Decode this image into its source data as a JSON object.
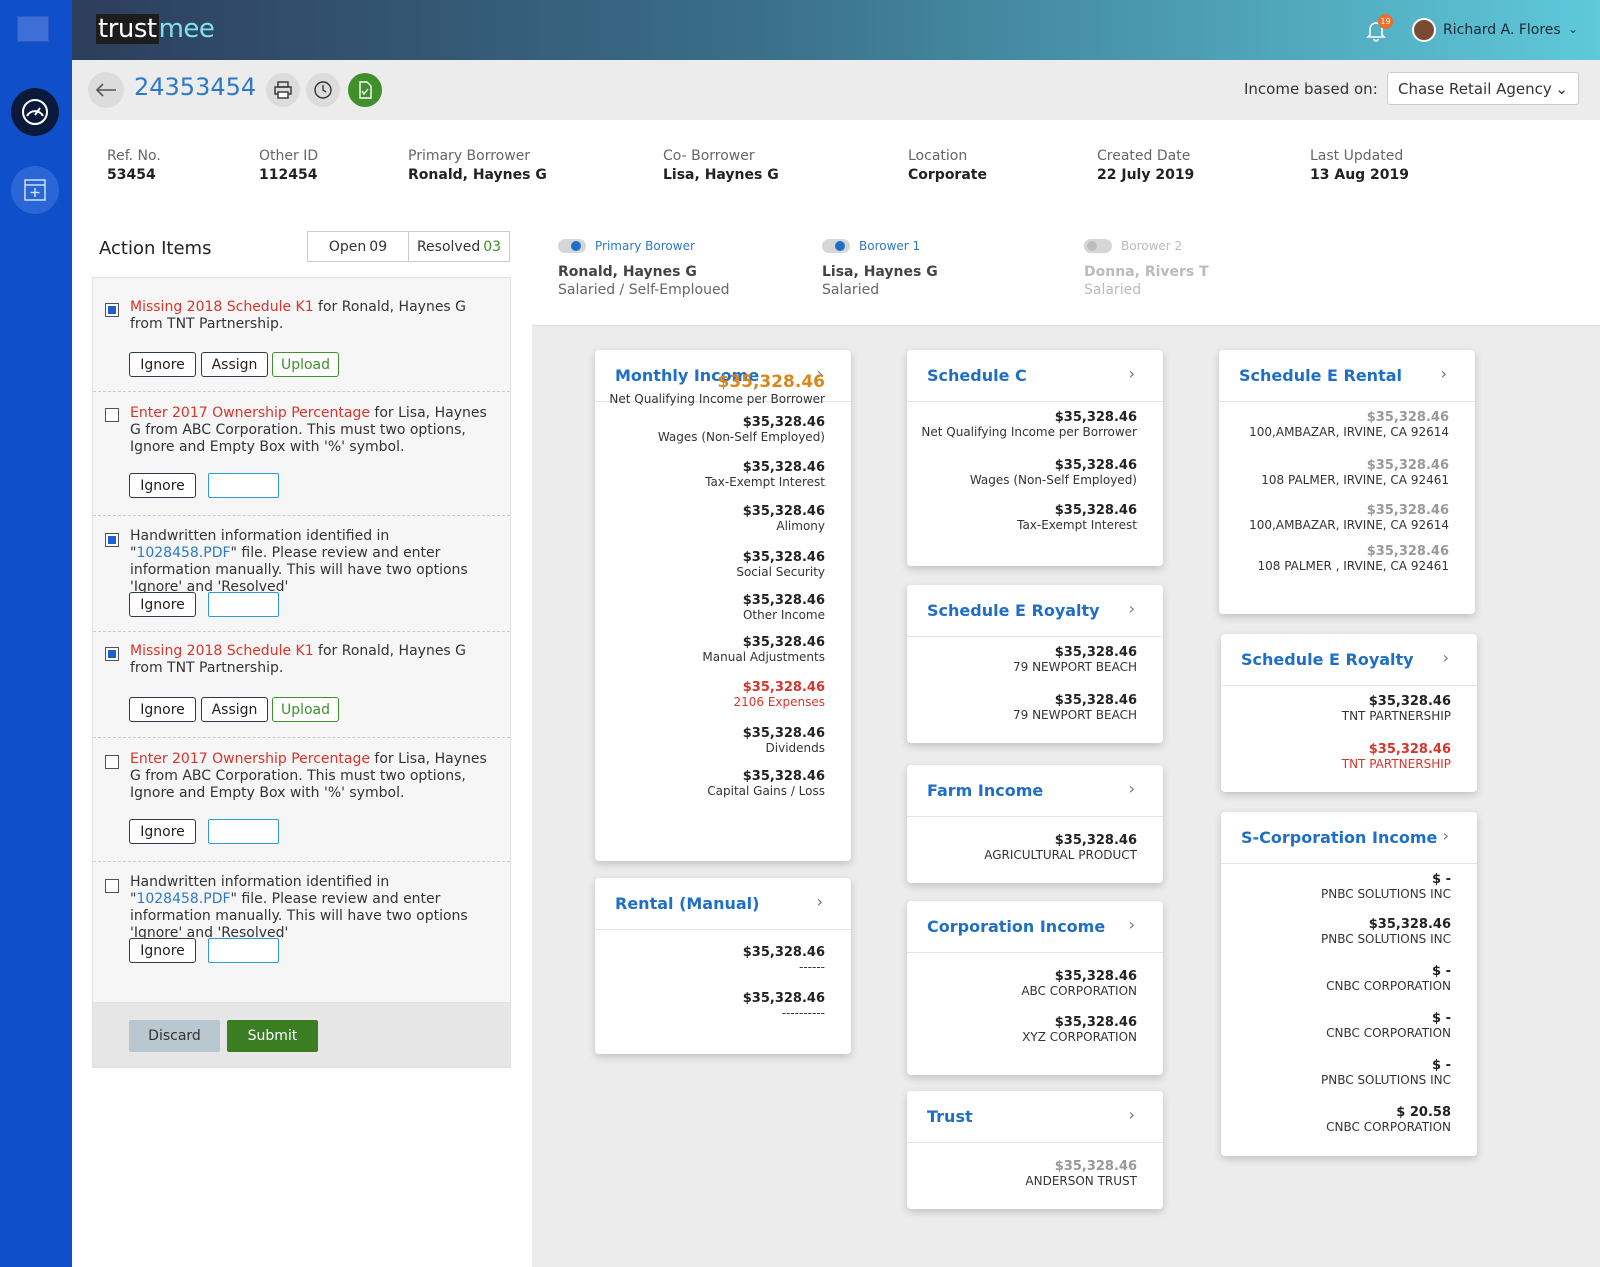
{
  "brand": {
    "part1": "trust",
    "part2": "mee"
  },
  "user": {
    "name": "Richard A. Flores",
    "notifications": "19"
  },
  "loan": {
    "id": "24353454"
  },
  "income_based": {
    "label": "Income based on:",
    "selected": "Chase Retail Agency"
  },
  "info": [
    {
      "label": "Ref. No.",
      "value": "53454"
    },
    {
      "label": "Other ID",
      "value": "112454"
    },
    {
      "label": "Primary Borrower",
      "value": "Ronald, Haynes G"
    },
    {
      "label": "Co- Borrower",
      "value": "Lisa, Haynes G"
    },
    {
      "label": "Location",
      "value": "Corporate"
    },
    {
      "label": "Created Date",
      "value": "22 July 2019"
    },
    {
      "label": "Last Updated",
      "value": "13 Aug 2019"
    }
  ],
  "action_items": {
    "title": "Action Items",
    "open_label": "Open",
    "open_count": "09",
    "resolved_label": "Resolved",
    "resolved_count": "03",
    "items": [
      {
        "checked": true,
        "highlight": "Missing 2018 Schedule K1",
        "text": " for Ronald, Haynes G from TNT Partnership.",
        "buttons": [
          "Ignore",
          "Assign",
          "Upload"
        ]
      },
      {
        "checked": false,
        "highlight": "Enter 2017 Ownership Percentage",
        "text": " for Lisa, Haynes G from ABC Corporation. This must two options, Ignore and Empty Box with '%' symbol.",
        "buttons": [
          "Ignore"
        ]
      },
      {
        "checked": true,
        "pre": "Handwritten information identified in \"",
        "link": "1028458.PDF",
        "post": "\" file. Please review and enter information manually. This will have two options 'Ignore' and 'Resolved'",
        "buttons": [
          "Ignore"
        ]
      },
      {
        "checked": true,
        "highlight": "Missing 2018 Schedule K1",
        "text": " for Ronald, Haynes G from TNT Partnership.",
        "buttons": [
          "Ignore",
          "Assign",
          "Upload"
        ]
      },
      {
        "checked": false,
        "highlight": "Enter 2017 Ownership Percentage",
        "text": " for Lisa, Haynes G from ABC Corporation. This must two options, Ignore and Empty Box with '%' symbol.",
        "buttons": [
          "Ignore"
        ]
      },
      {
        "checked": false,
        "pre": "Handwritten information identified in \"",
        "link": "1028458.PDF",
        "post": "\" file. Please review and enter information manually. This will have two options 'Ignore' and 'Resolved'",
        "buttons": [
          "Ignore"
        ]
      }
    ],
    "discard_label": "Discard",
    "submit_label": "Submit"
  },
  "borrowers": [
    {
      "toggle": "Primary Borower",
      "name": "Ronald, Haynes G",
      "type": "Salaried / Self-Emploued",
      "enabled": true
    },
    {
      "toggle": "Borower 1",
      "name": "Lisa, Haynes G",
      "type": "Salaried",
      "enabled": true
    },
    {
      "toggle": "Borower 2",
      "name": "Donna, Rivers T",
      "type": "Salaried",
      "enabled": false
    }
  ],
  "cards": {
    "monthly": {
      "title": "Monthly Income",
      "rows": [
        {
          "amount": "$35,328.46",
          "label": "Net Qualifying Income per Borrower",
          "style": "big"
        },
        {
          "amount": "$35,328.46",
          "label": "Wages (Non-Self Employed)"
        },
        {
          "amount": "$35,328.46",
          "label": "Tax-Exempt Interest"
        },
        {
          "amount": "$35,328.46",
          "label": "Alimony"
        },
        {
          "amount": "$35,328.46",
          "label": "Social Security"
        },
        {
          "amount": "$35,328.46",
          "label": "Other Income"
        },
        {
          "amount": "$35,328.46",
          "label": "Manual Adjustments"
        },
        {
          "amount": "$35,328.46",
          "label": "2106 Expenses",
          "style": "red"
        },
        {
          "amount": "$35,328.46",
          "label": "Dividends"
        },
        {
          "amount": "$35,328.46",
          "label": "Capital Gains / Loss"
        }
      ]
    },
    "rental_manual": {
      "title": "Rental (Manual)",
      "rows": [
        {
          "amount": "$35,328.46",
          "label": "------"
        },
        {
          "amount": "$35,328.46",
          "label": "----------"
        }
      ]
    },
    "schedule_c": {
      "title": "Schedule C",
      "rows": [
        {
          "amount": "$35,328.46",
          "label": "Net Qualifying Income per Borrower"
        },
        {
          "amount": "$35,328.46",
          "label": "Wages (Non-Self Employed)"
        },
        {
          "amount": "$35,328.46",
          "label": "Tax-Exempt Interest"
        }
      ]
    },
    "royalty_mid": {
      "title": "Schedule E Royalty",
      "rows": [
        {
          "amount": "$35,328.46",
          "label": "79 NEWPORT BEACH"
        },
        {
          "amount": "$35,328.46",
          "label": "79 NEWPORT BEACH"
        }
      ]
    },
    "farm": {
      "title": "Farm Income",
      "rows": [
        {
          "amount": "$35,328.46",
          "label": "AGRICULTURAL PRODUCT"
        }
      ]
    },
    "corporation": {
      "title": "Corporation Income",
      "rows": [
        {
          "amount": "$35,328.46",
          "label": "ABC CORPORATION"
        },
        {
          "amount": "$35,328.46",
          "label": "XYZ CORPORATION"
        }
      ]
    },
    "trust": {
      "title": "Trust",
      "rows": [
        {
          "amount": "$35,328.46",
          "label": "ANDERSON TRUST",
          "style": "grey"
        }
      ]
    },
    "rental_e": {
      "title": "Schedule E Rental",
      "rows": [
        {
          "amount": "$35,328.46",
          "label": "100,AMBAZAR, IRVINE, CA 92614",
          "style": "grey"
        },
        {
          "amount": "$35,328.46",
          "label": "108 PALMER, IRVINE, CA 92461",
          "style": "grey"
        },
        {
          "amount": "$35,328.46",
          "label": "100,AMBAZAR, IRVINE, CA 92614",
          "style": "grey"
        },
        {
          "amount": "$35,328.46",
          "label": "108 PALMER , IRVINE, CA 92461",
          "style": "grey"
        }
      ]
    },
    "royalty_right": {
      "title": "Schedule E Royalty",
      "rows": [
        {
          "amount": "$35,328.46",
          "label": "TNT PARTNERSHIP"
        },
        {
          "amount": "$35,328.46",
          "label": "TNT PARTNERSHIP",
          "style": "red"
        }
      ]
    },
    "scorp": {
      "title": "S-Corporation Income",
      "rows": [
        {
          "amount": "$ -",
          "label": "PNBC SOLUTIONS INC"
        },
        {
          "amount": "$35,328.46",
          "label": "PNBC SOLUTIONS INC"
        },
        {
          "amount": "$ -",
          "label": "CNBC CORPORATION"
        },
        {
          "amount": "$ -",
          "label": "CNBC CORPORATION"
        },
        {
          "amount": "$ -",
          "label": "PNBC SOLUTIONS INC"
        },
        {
          "amount": "$ 20.58",
          "label": "CNBC CORPORATION"
        }
      ]
    }
  }
}
